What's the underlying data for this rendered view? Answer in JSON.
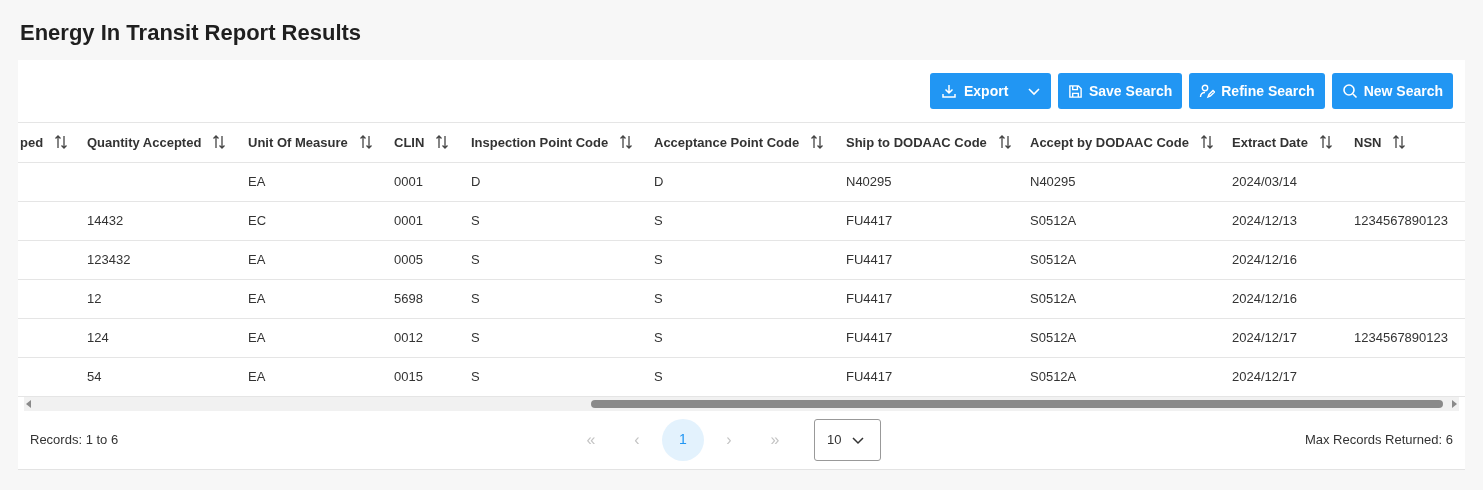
{
  "title": "Energy In Transit Report Results",
  "toolbar": {
    "export": {
      "label": "Export"
    },
    "buttons": [
      {
        "kind": "save",
        "label": "Save Search"
      },
      {
        "kind": "refine",
        "label": "Refine Search"
      },
      {
        "kind": "new",
        "label": "New Search"
      }
    ]
  },
  "table": {
    "columns": [
      {
        "label": "ped",
        "sortable": true
      },
      {
        "label": "Quantity Accepted",
        "sortable": true
      },
      {
        "label": "Unit Of Measure",
        "sortable": true
      },
      {
        "label": "CLIN",
        "sortable": true
      },
      {
        "label": "Inspection Point Code",
        "sortable": true
      },
      {
        "label": "Acceptance Point Code",
        "sortable": true
      },
      {
        "label": "Ship to DODAAC Code",
        "sortable": true
      },
      {
        "label": "Accept by DODAAC Code",
        "sortable": true
      },
      {
        "label": "Extract Date",
        "sortable": true
      },
      {
        "label": "NSN",
        "sortable": true
      }
    ],
    "rows": [
      [
        "",
        "",
        "EA",
        "0001",
        "D",
        "D",
        "N40295",
        "N40295",
        "2024/03/14",
        ""
      ],
      [
        "",
        "14432",
        "EC",
        "0001",
        "S",
        "S",
        "FU4417",
        "S0512A",
        "2024/12/13",
        "1234567890123"
      ],
      [
        "",
        "123432",
        "EA",
        "0005",
        "S",
        "S",
        "FU4417",
        "S0512A",
        "2024/12/16",
        ""
      ],
      [
        "",
        "12",
        "EA",
        "5698",
        "S",
        "S",
        "FU4417",
        "S0512A",
        "2024/12/16",
        ""
      ],
      [
        "",
        "124",
        "EA",
        "0012",
        "S",
        "S",
        "FU4417",
        "S0512A",
        "2024/12/17",
        "1234567890123"
      ],
      [
        "",
        "54",
        "EA",
        "0015",
        "S",
        "S",
        "FU4417",
        "S0512A",
        "2024/12/17",
        ""
      ]
    ]
  },
  "footer": {
    "records": "Records: 1 to 6",
    "pager": [
      {
        "kind": "first",
        "label": "«",
        "disabled": true
      },
      {
        "kind": "prev",
        "label": "‹",
        "disabled": true
      },
      {
        "kind": "page",
        "label": "1",
        "selected": true
      },
      {
        "kind": "next",
        "label": "›",
        "disabled": true
      },
      {
        "kind": "last",
        "label": "»",
        "disabled": true
      }
    ],
    "page_size": "10",
    "max_records": "Max Records Returned: 6"
  }
}
